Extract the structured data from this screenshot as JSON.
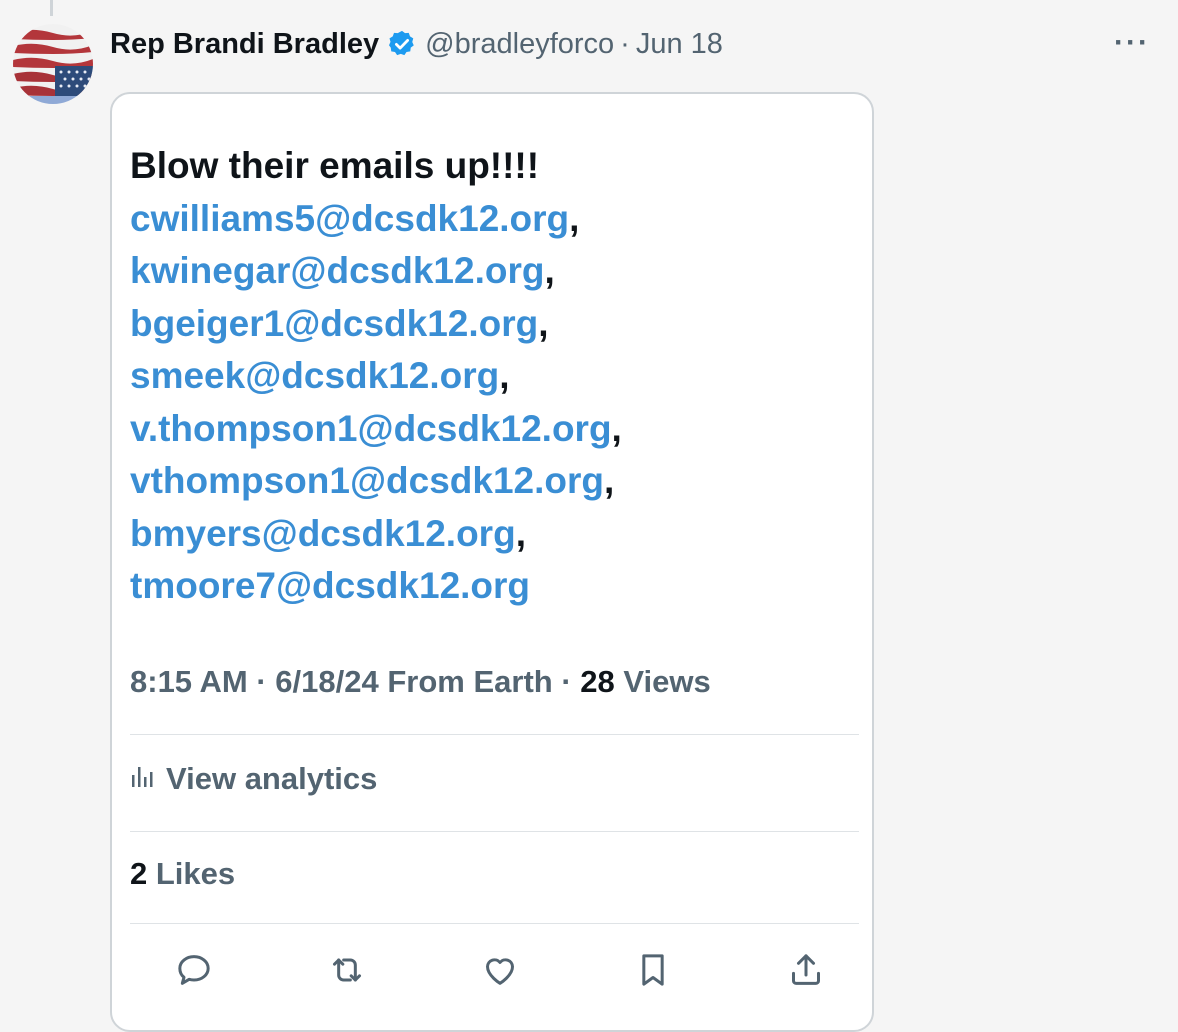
{
  "author": {
    "name": "Rep Brandi Bradley",
    "handle": "@bradleyforco",
    "date": "Jun 18"
  },
  "post": {
    "lines": [
      {
        "text": "Blow their emails up!!!!",
        "email": false,
        "comma": ""
      },
      {
        "text": "cwilliams5@dcsdk12.org",
        "email": true,
        "comma": ","
      },
      {
        "text": "kwinegar@dcsdk12.org",
        "email": true,
        "comma": ","
      },
      {
        "text": "bgeiger1@dcsdk12.org",
        "email": true,
        "comma": ","
      },
      {
        "text": "smeek@dcsdk12.org",
        "email": true,
        "comma": ","
      },
      {
        "text": "v.thompson1@dcsdk12.org",
        "email": true,
        "comma": ","
      },
      {
        "text": "vthompson1@dcsdk12.org",
        "email": true,
        "comma": ","
      },
      {
        "text": "bmyers@dcsdk12.org",
        "email": true,
        "comma": ","
      },
      {
        "text": "tmoore7@dcsdk12.org",
        "email": true,
        "comma": ""
      }
    ]
  },
  "meta": {
    "time": "8:15 AM",
    "date": "6/18/24",
    "source": "From Earth",
    "views_count": "28",
    "views_label": "Views"
  },
  "analytics_label": "View analytics",
  "likes": {
    "count": "2",
    "label": "Likes"
  },
  "colors": {
    "link": "#3a8ed4",
    "verified": "#1d9bf0",
    "muted": "#536471"
  },
  "icons": [
    "reply-icon",
    "repost-icon",
    "like-icon",
    "bookmark-icon",
    "share-icon"
  ]
}
